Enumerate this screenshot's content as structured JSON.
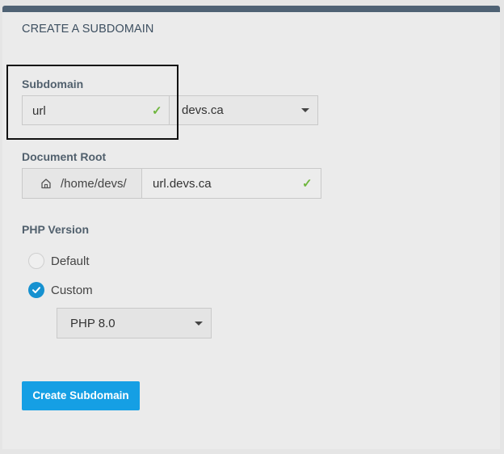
{
  "heading": "CREATE A SUBDOMAIN",
  "subdomain": {
    "label": "Subdomain",
    "value": "url",
    "domain_selected": "devs.ca"
  },
  "document_root": {
    "label": "Document Root",
    "prefix": "/home/devs/",
    "value": "url.devs.ca"
  },
  "php_version": {
    "label": "PHP Version",
    "options": [
      {
        "label": "Default",
        "checked": false
      },
      {
        "label": "Custom",
        "checked": true
      }
    ],
    "selected_version": "PHP 8.0"
  },
  "submit_label": "Create Subdomain",
  "icons": {
    "valid": "checkmark-icon",
    "home": "home-icon",
    "dropdown": "chevron-down-icon"
  },
  "colors": {
    "accent": "#159fe4",
    "header_bar": "#4f6274",
    "valid": "#6fb63e",
    "radio_checked": "#1691d0"
  }
}
